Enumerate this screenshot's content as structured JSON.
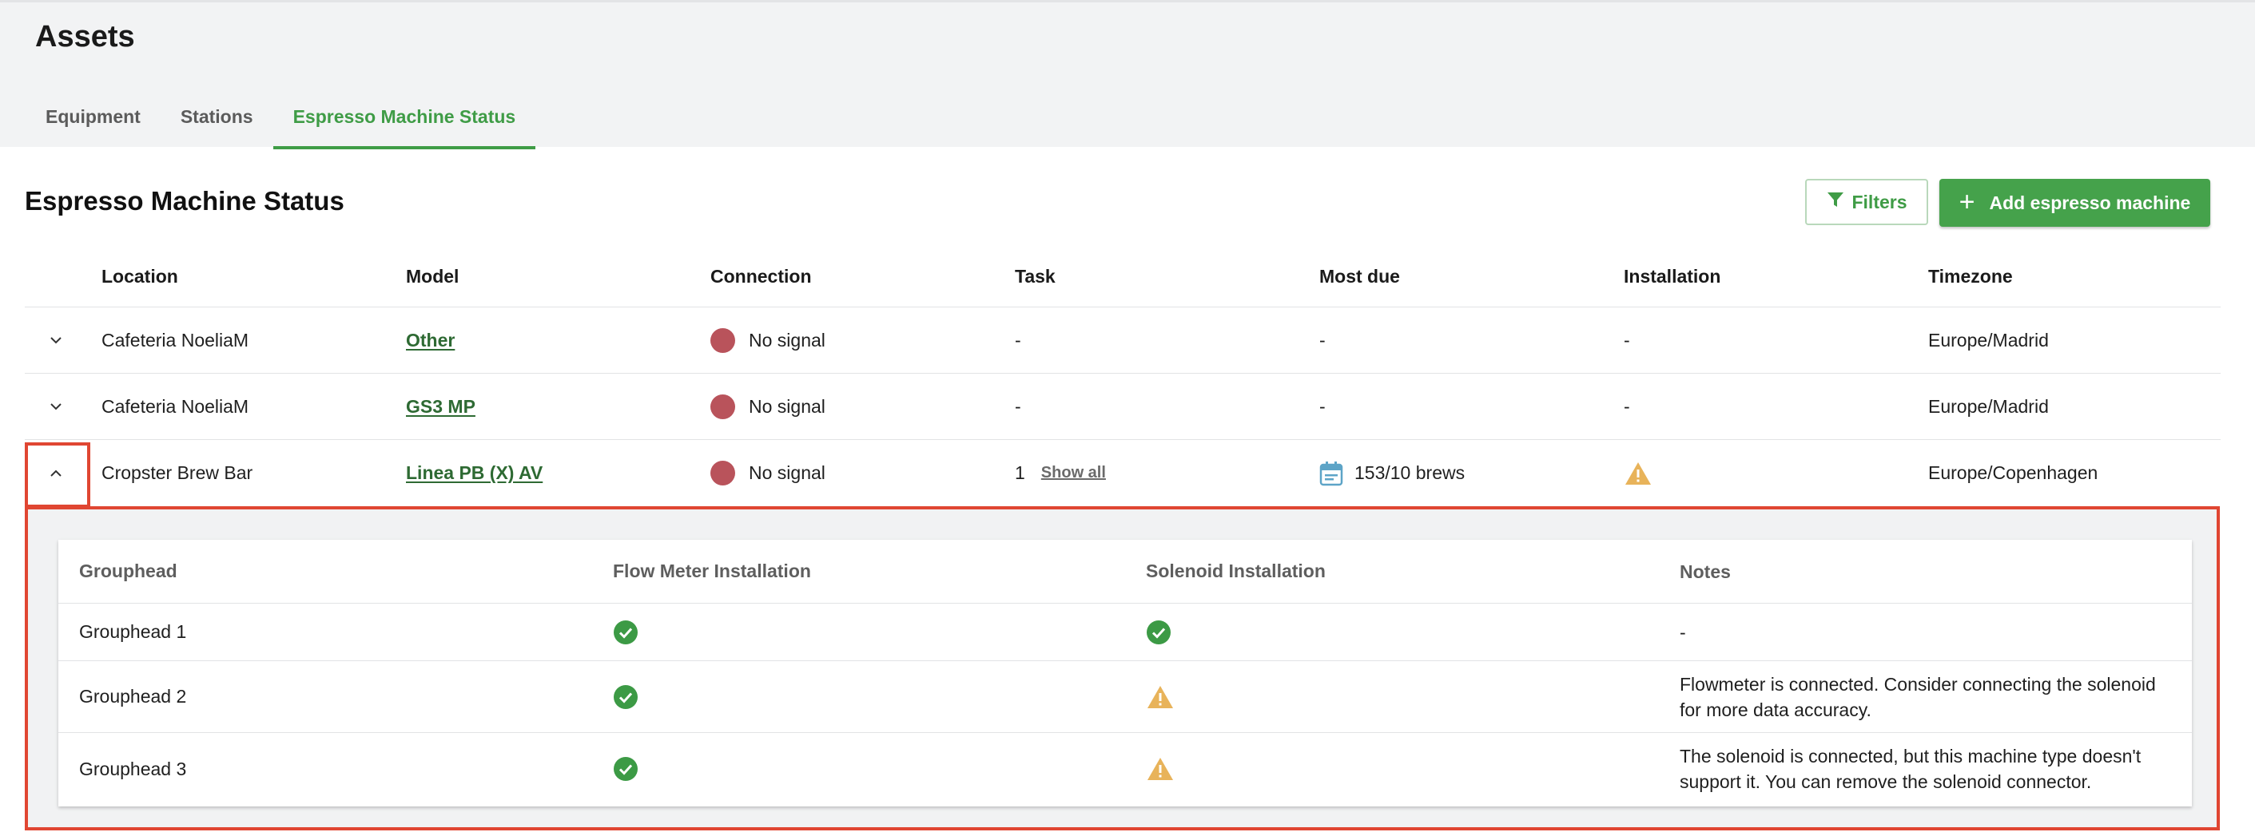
{
  "page": {
    "title": "Assets"
  },
  "tabs": [
    {
      "label": "Equipment",
      "active": false
    },
    {
      "label": "Stations",
      "active": false
    },
    {
      "label": "Espresso Machine Status",
      "active": true
    }
  ],
  "section": {
    "title": "Espresso Machine Status",
    "filters_label": "Filters",
    "add_label": "Add espresso machine"
  },
  "colors": {
    "accent": "#3f9c46",
    "no_signal": "#b9535b",
    "warning": "#e8b35a",
    "highlight": "#e04632"
  },
  "table": {
    "columns": [
      "Location",
      "Model",
      "Connection",
      "Task",
      "Most due",
      "Installation",
      "Timezone"
    ],
    "rows": [
      {
        "location": "Cafeteria NoeliaM",
        "model": "Other",
        "connection": "No signal",
        "task": "-",
        "most_due": "-",
        "installation": "-",
        "timezone": "Europe/Madrid",
        "expanded": false
      },
      {
        "location": "Cafeteria NoeliaM",
        "model": "GS3 MP",
        "connection": "No signal",
        "task": "-",
        "most_due": "-",
        "installation": "-",
        "timezone": "Europe/Madrid",
        "expanded": false
      },
      {
        "location": "Cropster Brew Bar",
        "model": "Linea PB (X) AV",
        "connection": "No signal",
        "task": "1",
        "task_link": "Show all",
        "most_due": "153/10 brews",
        "most_due_icon": "calendar-icon",
        "installation_icon": "warning-icon",
        "timezone": "Europe/Copenhagen",
        "expanded": true
      }
    ]
  },
  "details": {
    "columns": [
      "Grouphead",
      "Flow Meter Installation",
      "Solenoid Installation",
      "Notes"
    ],
    "rows": [
      {
        "grouphead": "Grouphead 1",
        "flow_meter_icon": "check-circle-icon",
        "solenoid_icon": "check-circle-icon",
        "notes": "-"
      },
      {
        "grouphead": "Grouphead 2",
        "flow_meter_icon": "check-circle-icon",
        "solenoid_icon": "warning-icon",
        "notes": "Flowmeter is connected. Consider connecting the solenoid for more data accuracy."
      },
      {
        "grouphead": "Grouphead 3",
        "flow_meter_icon": "check-circle-icon",
        "solenoid_icon": "warning-icon",
        "notes": "The solenoid is connected, but this machine type doesn't support it. You can remove the solenoid connector."
      }
    ]
  }
}
